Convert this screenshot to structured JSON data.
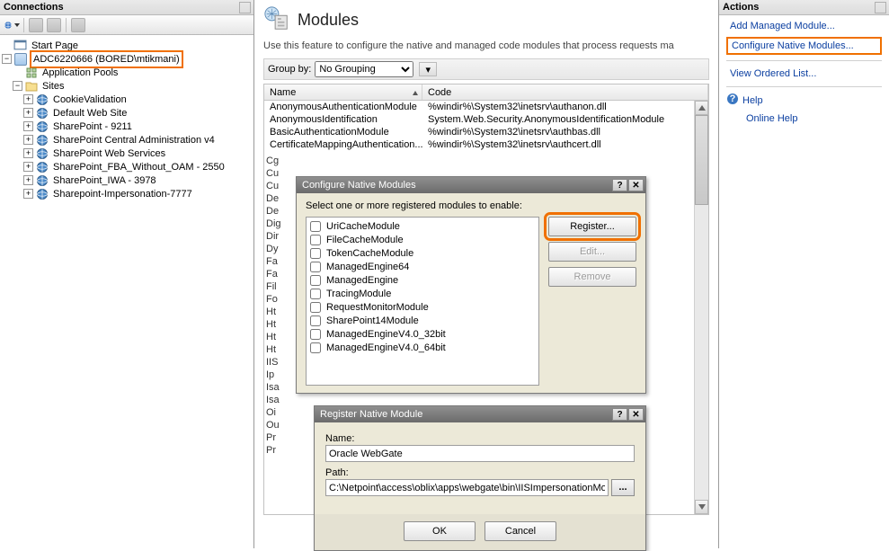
{
  "connections": {
    "title": "Connections",
    "tree": {
      "start": "Start Page",
      "server": "ADC6220666 (BORED\\mtikmani)",
      "apppools": "Application Pools",
      "sites": "Sites",
      "siteList": [
        "CookieValidation",
        "Default Web Site",
        "SharePoint - 9211",
        "SharePoint Central Administration v4",
        "SharePoint Web Services",
        "SharePoint_FBA_Without_OAM - 2550",
        "SharePoint_IWA - 3978",
        "Sharepoint-Impersonation-7777"
      ]
    }
  },
  "center": {
    "title": "Modules",
    "desc": "Use this feature to configure the native and managed code modules that process requests ma",
    "groupBy": "Group by:",
    "groupVal": "No Grouping",
    "cols": {
      "name": "Name",
      "code": "Code"
    },
    "rows": [
      {
        "n": "AnonymousAuthenticationModule",
        "c": "%windir%\\System32\\inetsrv\\authanon.dll"
      },
      {
        "n": "AnonymousIdentification",
        "c": "System.Web.Security.AnonymousIdentificationModule"
      },
      {
        "n": "BasicAuthenticationModule",
        "c": "%windir%\\System32\\inetsrv\\authbas.dll"
      },
      {
        "n": "CertificateMappingAuthentication...",
        "c": "%windir%\\System32\\inetsrv\\authcert.dll"
      }
    ],
    "stubs": [
      "Cg",
      "Cu",
      "Cu",
      "De",
      "De",
      "Dig",
      "Dir",
      "Dy",
      "Fa",
      "Fa",
      "Fil",
      "Fo",
      "Ht",
      "Ht",
      "Ht",
      "Ht",
      "IIS",
      "Ip",
      "Isa",
      "Isa",
      "Oi",
      "Ou",
      "Pr",
      "Pr"
    ]
  },
  "actions": {
    "title": "Actions",
    "addManaged": "Add Managed Module...",
    "configNative": "Configure Native Modules...",
    "viewOrdered": "View Ordered List...",
    "help": "Help",
    "onlineHelp": "Online Help"
  },
  "cfgDlg": {
    "title": "Configure Native Modules",
    "prompt": "Select one or more registered modules to enable:",
    "items": [
      "UriCacheModule",
      "FileCacheModule",
      "TokenCacheModule",
      "ManagedEngine64",
      "ManagedEngine",
      "TracingModule",
      "RequestMonitorModule",
      "SharePoint14Module",
      "ManagedEngineV4.0_32bit",
      "ManagedEngineV4.0_64bit"
    ],
    "btnRegister": "Register...",
    "btnEdit": "Edit...",
    "btnRemove": "Remove"
  },
  "regDlg": {
    "title": "Register Native Module",
    "nameLbl": "Name:",
    "nameVal": "Oracle WebGate",
    "pathLbl": "Path:",
    "pathVal": "C:\\Netpoint\\access\\oblix\\apps\\webgate\\bin\\IISImpersonationMod",
    "ok": "OK",
    "cancel": "Cancel",
    "browse": "..."
  }
}
